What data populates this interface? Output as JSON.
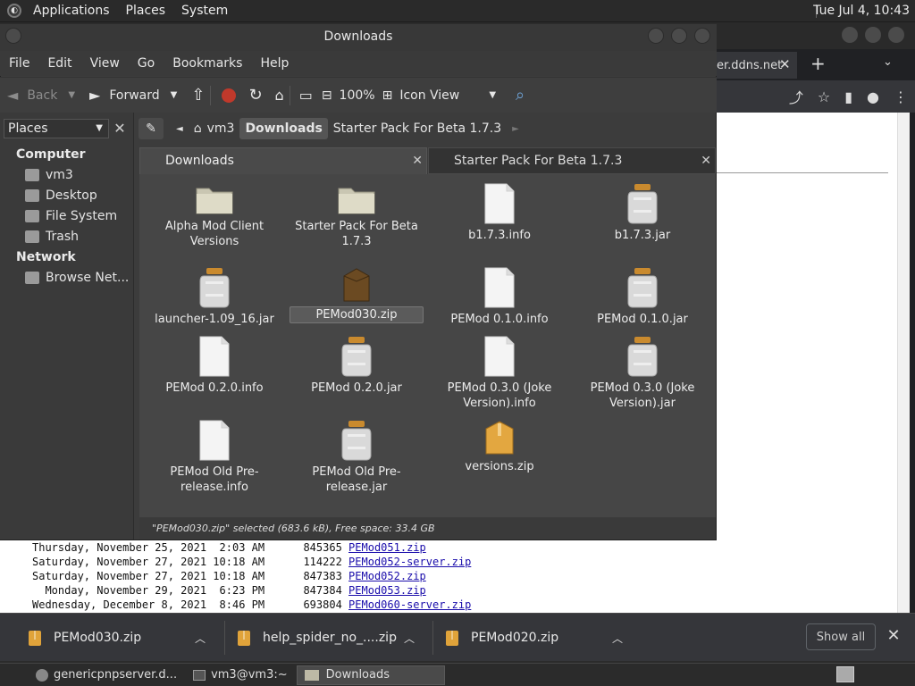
{
  "top_panel": {
    "menus": [
      "Applications",
      "Places",
      "System"
    ],
    "clock": "Tue Jul  4, 10:43"
  },
  "browser": {
    "tab_text": "er.ddns.net",
    "listing": [
      {
        "date": "Thursday, November 25, 2021  2:03 AM",
        "size": "845365",
        "file": "PEMod051.zip"
      },
      {
        "date": "Saturday, November 27, 2021 10:18 AM",
        "size": "114222",
        "file": "PEMod052-server.zip"
      },
      {
        "date": "Saturday, November 27, 2021 10:18 AM",
        "size": "847383",
        "file": "PEMod052.zip"
      },
      {
        "date": "  Monday, November 29, 2021  6:23 PM",
        "size": "847384",
        "file": "PEMod053.zip"
      },
      {
        "date": "Wednesday, December 8, 2021  8:46 PM",
        "size": "693804",
        "file": "PEMod060-server.zip"
      }
    ]
  },
  "downloads_bar": {
    "items": [
      "PEMod030.zip",
      "help_spider_no_....zip",
      "PEMod020.zip"
    ],
    "show_all": "Show all"
  },
  "taskbar": {
    "items": [
      "genericpnpserver.d...",
      "vm3@vm3:~",
      "Downloads"
    ]
  },
  "file_manager": {
    "title": "Downloads",
    "menu": [
      "File",
      "Edit",
      "View",
      "Go",
      "Bookmarks",
      "Help"
    ],
    "toolbar": {
      "back": "Back",
      "forward": "Forward",
      "zoom": "100%",
      "view_mode": "Icon View"
    },
    "sidebar": {
      "combo": "Places",
      "computer_head": "Computer",
      "computer_items": [
        "vm3",
        "Desktop",
        "File System",
        "Trash"
      ],
      "network_head": "Network",
      "network_items": [
        "Browse Net..."
      ]
    },
    "breadcrumbs": [
      "vm3",
      "Downloads",
      "Starter Pack For Beta 1.7.3"
    ],
    "tabs": [
      "Downloads",
      "Starter Pack For Beta 1.7.3"
    ],
    "files": [
      {
        "name": "Alpha Mod Client Versions",
        "type": "folder"
      },
      {
        "name": "Starter Pack For Beta 1.7.3",
        "type": "folder"
      },
      {
        "name": "b1.7.3.info",
        "type": "doc"
      },
      {
        "name": "b1.7.3.jar",
        "type": "jar"
      },
      {
        "name": "launcher-1.09_16.jar",
        "type": "jar"
      },
      {
        "name": "PEMod030.zip",
        "type": "zip"
      },
      {
        "name": "PEMod 0.1.0.info",
        "type": "doc"
      },
      {
        "name": "PEMod 0.1.0.jar",
        "type": "jar"
      },
      {
        "name": "PEMod 0.2.0.info",
        "type": "doc"
      },
      {
        "name": "PEMod 0.2.0.jar",
        "type": "jar"
      },
      {
        "name": "PEMod 0.3.0 (Joke Version).info",
        "type": "doc"
      },
      {
        "name": "PEMod 0.3.0 (Joke Version).jar",
        "type": "jar"
      },
      {
        "name": "PEMod Old Pre-release.info",
        "type": "doc"
      },
      {
        "name": "PEMod Old Pre-release.jar",
        "type": "jar"
      },
      {
        "name": "versions.zip",
        "type": "zip2"
      }
    ],
    "status": "\"PEMod030.zip\" selected (683.6 kB), Free space: 33.4 GB"
  }
}
